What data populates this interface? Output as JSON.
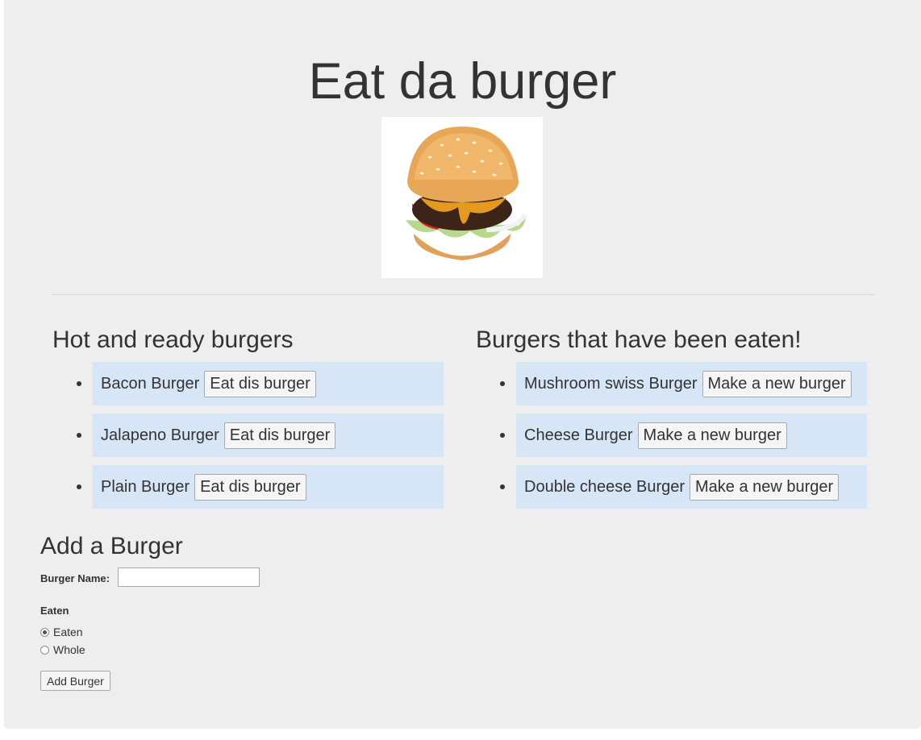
{
  "header": {
    "title": "Eat da burger",
    "image_icon": "burger-image"
  },
  "hot_column": {
    "heading": "Hot and ready burgers",
    "items": [
      {
        "name": "Bacon Burger",
        "button": "Eat dis burger"
      },
      {
        "name": "Jalapeno Burger",
        "button": "Eat dis burger"
      },
      {
        "name": "Plain Burger",
        "button": "Eat dis burger"
      }
    ]
  },
  "eaten_column": {
    "heading": "Burgers that have been eaten!",
    "items": [
      {
        "name": "Mushroom swiss Burger",
        "button": "Make a new burger"
      },
      {
        "name": "Cheese Burger",
        "button": "Make a new burger"
      },
      {
        "name": "Double cheese Burger",
        "button": "Make a new burger"
      }
    ]
  },
  "form": {
    "title": "Add a Burger",
    "name_label": "Burger Name:",
    "name_value": "",
    "eaten_label": "Eaten",
    "options": [
      {
        "label": "Eaten",
        "checked": true
      },
      {
        "label": "Whole",
        "checked": false
      }
    ],
    "submit_label": "Add Burger"
  },
  "colors": {
    "background": "#eeeeee",
    "list_item_bg": "#d6e6f7"
  }
}
